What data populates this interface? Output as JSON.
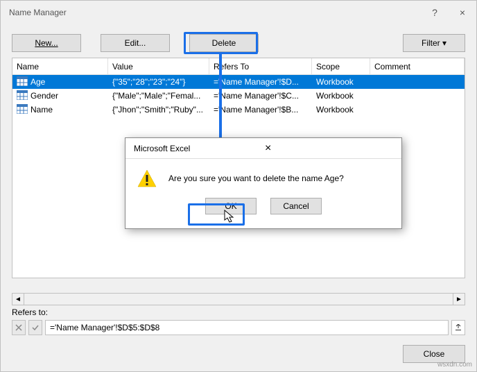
{
  "window": {
    "title": "Name Manager",
    "help": "?",
    "close": "×"
  },
  "toolbar": {
    "new": "New...",
    "edit": "Edit...",
    "delete": "Delete",
    "filter": "Filter ▾"
  },
  "columns": {
    "name": "Name",
    "value": "Value",
    "refers": "Refers To",
    "scope": "Scope",
    "comment": "Comment"
  },
  "rows": [
    {
      "name": "Age",
      "value": "{\"35\";\"28\";\"23\";\"24\"}",
      "refers": "='Name Manager'!$D...",
      "scope": "Workbook",
      "comment": "",
      "selected": true
    },
    {
      "name": "Gender",
      "value": "{\"Male\";\"Male\";\"Femal...",
      "refers": "='Name Manager'!$C...",
      "scope": "Workbook",
      "comment": "",
      "selected": false
    },
    {
      "name": "Name",
      "value": "{\"Jhon\";\"Smith\";\"Ruby\"...",
      "refers": "='Name Manager'!$B...",
      "scope": "Workbook",
      "comment": "",
      "selected": false
    }
  ],
  "refersTo": {
    "label": "Refers to:",
    "value": "='Name Manager'!$D$5:$D$8"
  },
  "footer": {
    "close": "Close"
  },
  "confirm": {
    "title": "Microsoft Excel",
    "close": "×",
    "message": "Are you sure you want to delete the name Age?",
    "ok": "OK",
    "cancel": "Cancel"
  },
  "watermark": "wsxdn.com"
}
